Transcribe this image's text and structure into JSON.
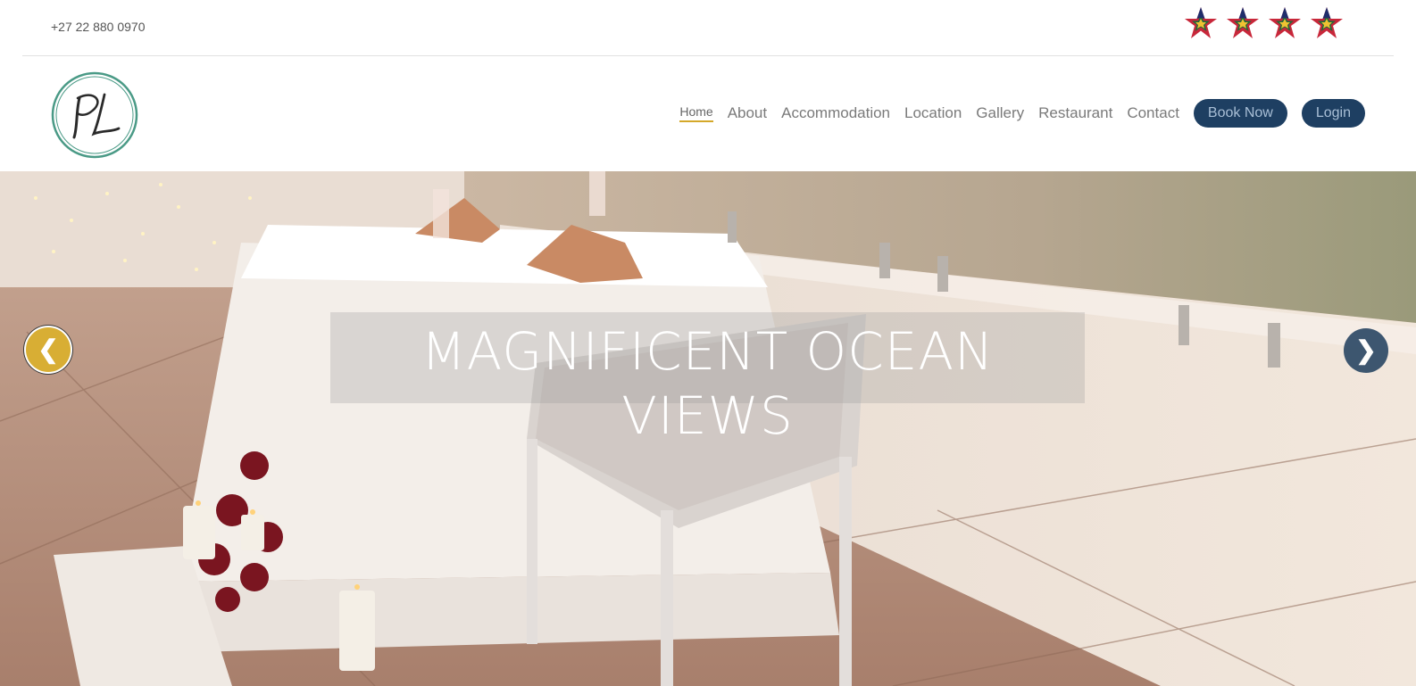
{
  "topbar": {
    "phone": "+27 22 880 0970",
    "star_rating": 4
  },
  "header": {
    "logo_text": "PL",
    "nav": [
      {
        "label": "Home",
        "active": true
      },
      {
        "label": "About"
      },
      {
        "label": "Accommodation"
      },
      {
        "label": "Location"
      },
      {
        "label": "Gallery"
      },
      {
        "label": "Restaurant"
      },
      {
        "label": "Contact"
      }
    ],
    "book_label": "Book Now",
    "login_label": "Login"
  },
  "hero": {
    "caption": "MAGNIFICENT OCEAN VIEWS",
    "prev_icon": "chevron-left-icon",
    "next_icon": "chevron-right-icon"
  },
  "colors": {
    "accent_gold": "#d8ae34",
    "navy": "#1e3f62",
    "logo_teal": "#4a9a86"
  }
}
